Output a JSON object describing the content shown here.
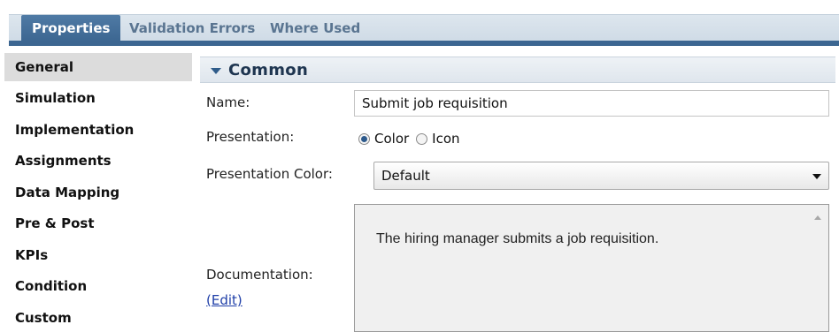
{
  "tabs": [
    {
      "label": "Properties",
      "active": true
    },
    {
      "label": "Validation Errors",
      "active": false
    },
    {
      "label": "Where Used",
      "active": false
    }
  ],
  "sidebar": {
    "items": [
      {
        "label": "General",
        "selected": true
      },
      {
        "label": "Simulation"
      },
      {
        "label": "Implementation"
      },
      {
        "label": "Assignments"
      },
      {
        "label": "Data Mapping"
      },
      {
        "label": "Pre & Post"
      },
      {
        "label": "KPIs"
      },
      {
        "label": "Condition"
      },
      {
        "label": "Custom"
      }
    ]
  },
  "section": {
    "title": "Common",
    "toggle_icon": "triangle-down-icon"
  },
  "fields": {
    "name_label": "Name:",
    "name_value": "Submit job requisition",
    "presentation_label": "Presentation:",
    "presentation_options": [
      {
        "label": "Color",
        "checked": true
      },
      {
        "label": "Icon",
        "checked": false
      }
    ],
    "presentation_color_label": "Presentation Color:",
    "presentation_color_value": "Default",
    "documentation_label": "Documentation:",
    "documentation_edit_link": "(Edit)",
    "documentation_text": "The hiring manager submits a job requisition."
  },
  "colors": {
    "tab_active": "#3c6691",
    "tab_inactive_text": "#5a7591",
    "link": "#1f3fa8",
    "radio_dot": "#2d5a8c"
  }
}
